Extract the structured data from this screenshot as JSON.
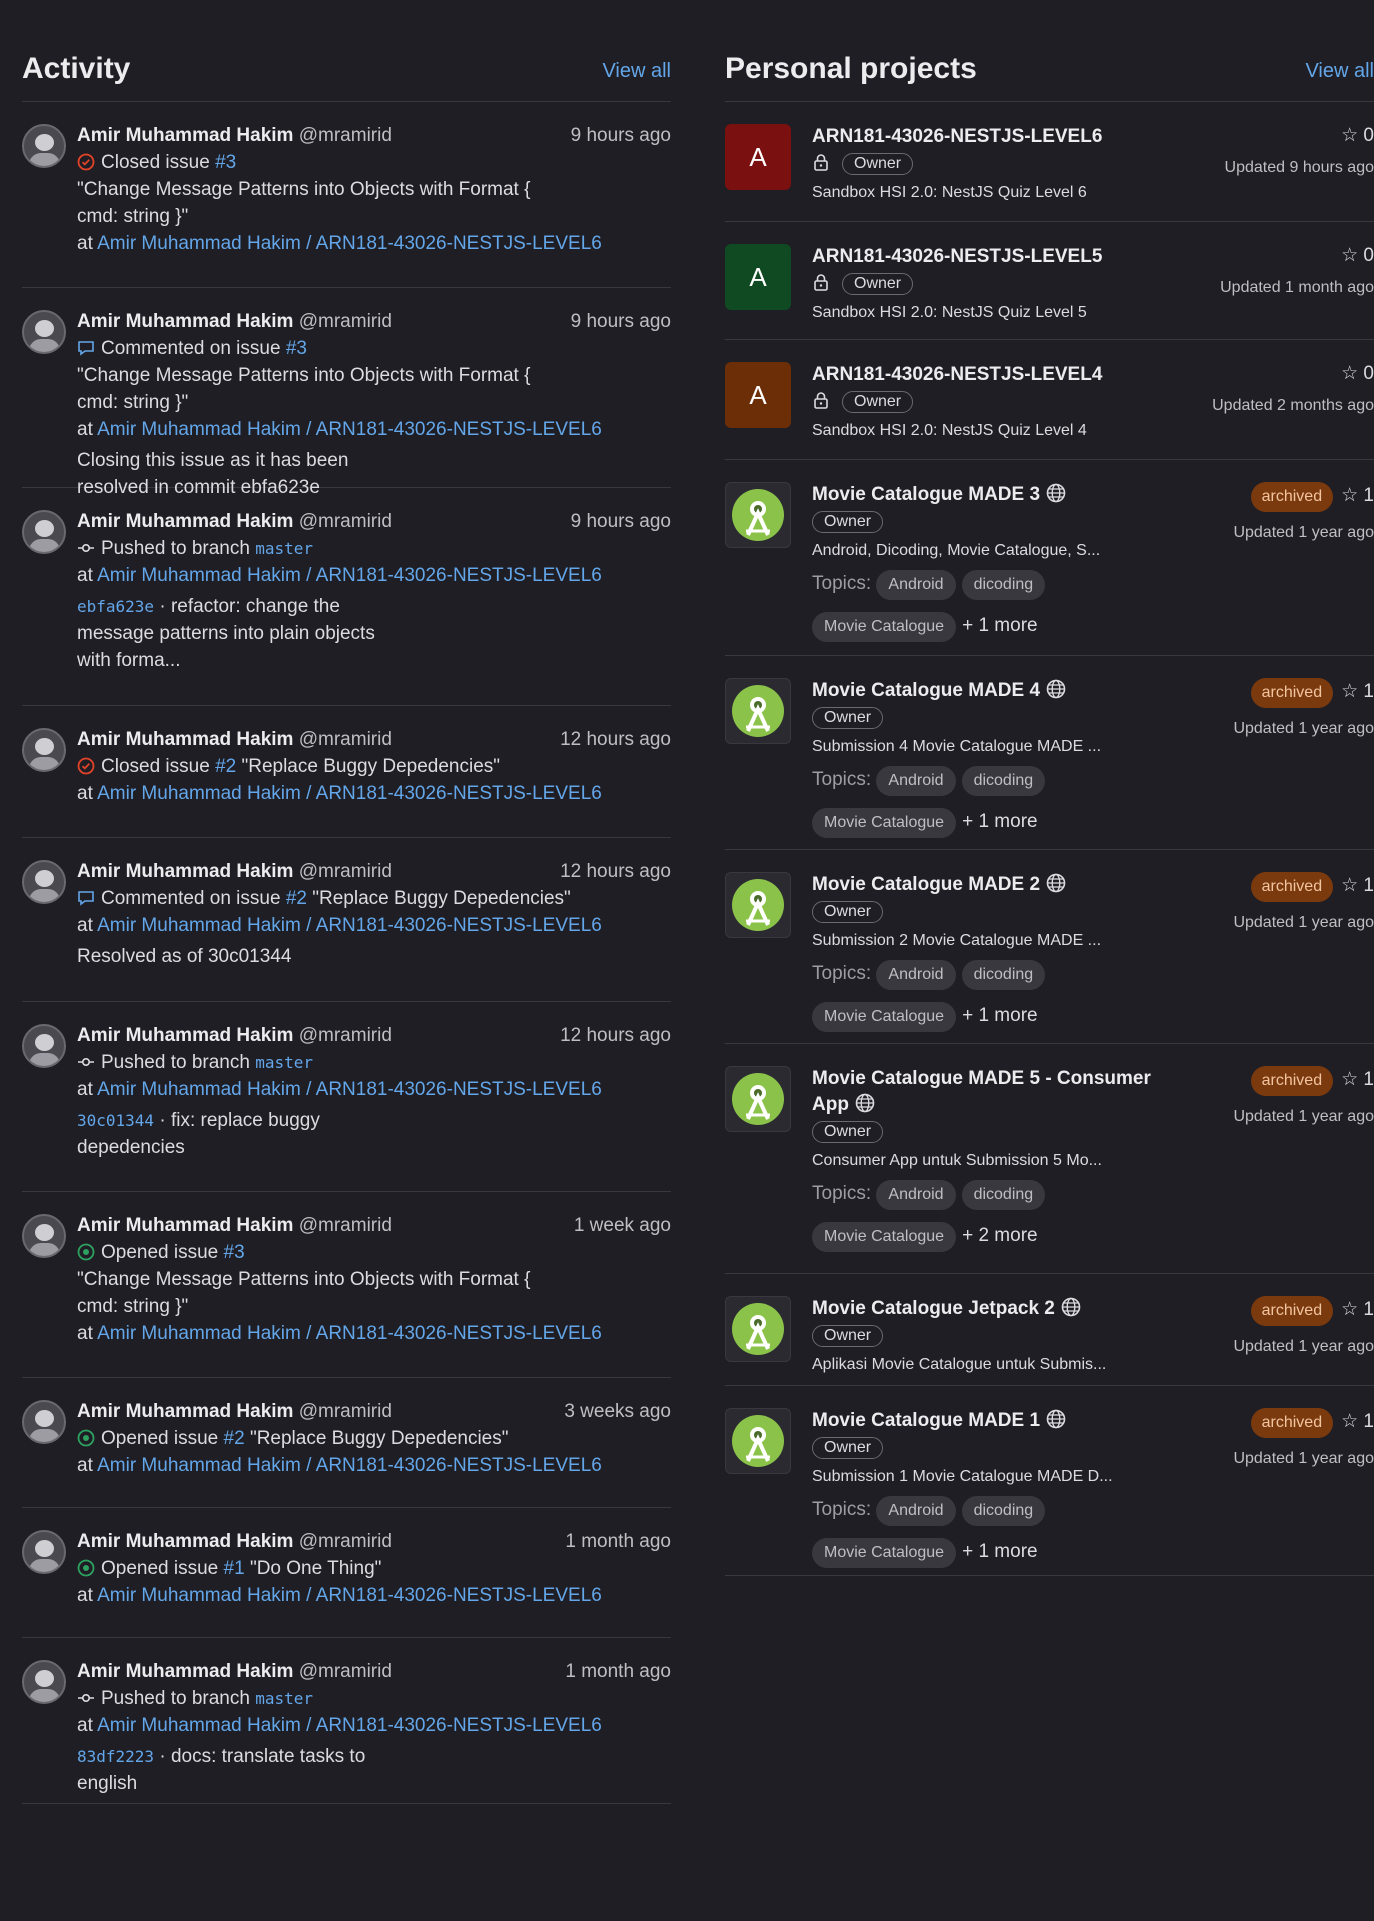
{
  "activity": {
    "title": "Activity",
    "view_all": "View all",
    "items": [
      {
        "name": "Amir Muhammad Hakim",
        "handle": "@mramirid",
        "time": "9 hours ago",
        "action": "Closed issue",
        "ref": "#3",
        "quote": "\"Change Message Patterns into Objects with Format { cmd: string }\"",
        "at": "at",
        "project": "Amir Muhammad Hakim / ARN181-43026-NESTJS-LEVEL6"
      },
      {
        "name": "Amir Muhammad Hakim",
        "handle": "@mramirid",
        "time": "9 hours ago",
        "action": "Commented on issue",
        "ref": "#3",
        "quote": "\"Change Message Patterns into Objects with Format { cmd: string }\"",
        "at": "at",
        "project": "Amir Muhammad Hakim / ARN181-43026-NESTJS-LEVEL6",
        "note": "Closing this issue as it has been resolved in commit ebfa623e"
      },
      {
        "name": "Amir Muhammad Hakim",
        "handle": "@mramirid",
        "time": "9 hours ago",
        "action": "Pushed to branch",
        "branch": "master",
        "at": "at",
        "project": "Amir Muhammad Hakim / ARN181-43026-NESTJS-LEVEL6",
        "commit": "ebfa623e",
        "commit_msg": "· refactor: change the message patterns into plain objects with forma..."
      },
      {
        "name": "Amir Muhammad Hakim",
        "handle": "@mramirid",
        "time": "12 hours ago",
        "action": "Closed issue",
        "ref": "#2",
        "quote": "\"Replace Buggy Depedencies\"",
        "at": "at",
        "project": "Amir Muhammad Hakim / ARN181-43026-NESTJS-LEVEL6"
      },
      {
        "name": "Amir Muhammad Hakim",
        "handle": "@mramirid",
        "time": "12 hours ago",
        "action": "Commented on issue",
        "ref": "#2",
        "quote": "\"Replace Buggy Depedencies\"",
        "at": "at",
        "project": "Amir Muhammad Hakim / ARN181-43026-NESTJS-LEVEL6",
        "note": "Resolved as of 30c01344"
      },
      {
        "name": "Amir Muhammad Hakim",
        "handle": "@mramirid",
        "time": "12 hours ago",
        "action": "Pushed to branch",
        "branch": "master",
        "at": "at",
        "project": "Amir Muhammad Hakim / ARN181-43026-NESTJS-LEVEL6",
        "commit": "30c01344",
        "commit_msg": "· fix: replace buggy depedencies"
      },
      {
        "name": "Amir Muhammad Hakim",
        "handle": "@mramirid",
        "time": "1 week ago",
        "action": "Opened issue",
        "ref": "#3",
        "quote": "\"Change Message Patterns into Objects with Format { cmd: string }\"",
        "at": "at",
        "project": "Amir Muhammad Hakim / ARN181-43026-NESTJS-LEVEL6"
      },
      {
        "name": "Amir Muhammad Hakim",
        "handle": "@mramirid",
        "time": "3 weeks ago",
        "action": "Opened issue",
        "ref": "#2",
        "quote": "\"Replace Buggy Depedencies\"",
        "at": "at",
        "project": "Amir Muhammad Hakim / ARN181-43026-NESTJS-LEVEL6"
      },
      {
        "name": "Amir Muhammad Hakim",
        "handle": "@mramirid",
        "time": "1 month ago",
        "action": "Opened issue",
        "ref": "#1",
        "quote": "\"Do One Thing\"",
        "at": "at",
        "project": "Amir Muhammad Hakim / ARN181-43026-NESTJS-LEVEL6"
      },
      {
        "name": "Amir Muhammad Hakim",
        "handle": "@mramirid",
        "time": "1 month ago",
        "action": "Pushed to branch",
        "branch": "master",
        "at": "at",
        "project": "Amir Muhammad Hakim / ARN181-43026-NESTJS-LEVEL6",
        "commit": "83df2223",
        "commit_msg": "· docs: translate tasks to english"
      }
    ]
  },
  "projects": {
    "title": "Personal projects",
    "view_all": "View all",
    "items": [
      {
        "letter": "A",
        "color": "#7a1010",
        "name": "ARN181-43026-NESTJS-LEVEL6",
        "owner": "Owner",
        "desc": "Sandbox HSI 2.0: NestJS Quiz Level 6",
        "stars": "0",
        "updated": "Updated 9 hours ago"
      },
      {
        "letter": "A",
        "color": "#0f4a22",
        "name": "ARN181-43026-NESTJS-LEVEL5",
        "owner": "Owner",
        "desc": "Sandbox HSI 2.0: NestJS Quiz Level 5",
        "stars": "0",
        "updated": "Updated 1 month ago"
      },
      {
        "letter": "A",
        "color": "#6b2e06",
        "name": "ARN181-43026-NESTJS-LEVEL4",
        "owner": "Owner",
        "desc": "Sandbox HSI 2.0: NestJS Quiz Level 4",
        "stars": "0",
        "updated": "Updated 2 months ago"
      },
      {
        "name": "Movie Catalogue MADE 3",
        "owner": "Owner",
        "desc": "Android, Dicoding, Movie Catalogue, S...",
        "topics_label": "Topics:",
        "topics": [
          "Android",
          "dicoding",
          "Movie Catalogue"
        ],
        "more": "+ 1 more",
        "badge": "archived",
        "stars": "1",
        "updated": "Updated 1 year ago"
      },
      {
        "name": "Movie Catalogue MADE 4",
        "owner": "Owner",
        "desc": "Submission 4 Movie Catalogue MADE ...",
        "topics_label": "Topics:",
        "topics": [
          "Android",
          "dicoding",
          "Movie Catalogue"
        ],
        "more": "+ 1 more",
        "badge": "archived",
        "stars": "1",
        "updated": "Updated 1 year ago"
      },
      {
        "name": "Movie Catalogue MADE 2",
        "owner": "Owner",
        "desc": "Submission 2 Movie Catalogue MADE ...",
        "topics_label": "Topics:",
        "topics": [
          "Android",
          "dicoding",
          "Movie Catalogue"
        ],
        "more": "+ 1 more",
        "badge": "archived",
        "stars": "1",
        "updated": "Updated 1 year ago"
      },
      {
        "name": "Movie Catalogue MADE 5 - Consumer App",
        "owner": "Owner",
        "desc": "Consumer App untuk Submission 5 Mo...",
        "topics_label": "Topics:",
        "topics": [
          "Android",
          "dicoding",
          "Movie Catalogue"
        ],
        "more": "+ 2 more",
        "badge": "archived",
        "stars": "1",
        "updated": "Updated 1 year ago"
      },
      {
        "name": "Movie Catalogue Jetpack 2",
        "owner": "Owner",
        "desc": "Aplikasi Movie Catalogue untuk Submis...",
        "badge": "archived",
        "stars": "1",
        "updated": "Updated 1 year ago"
      },
      {
        "name": "Movie Catalogue MADE 1",
        "owner": "Owner",
        "desc": "Submission 1 Movie Catalogue MADE D...",
        "topics_label": "Topics:",
        "topics": [
          "Android",
          "dicoding",
          "Movie Catalogue"
        ],
        "more": "+ 1 more",
        "badge": "archived",
        "stars": "1",
        "updated": "Updated 1 year ago"
      }
    ]
  }
}
